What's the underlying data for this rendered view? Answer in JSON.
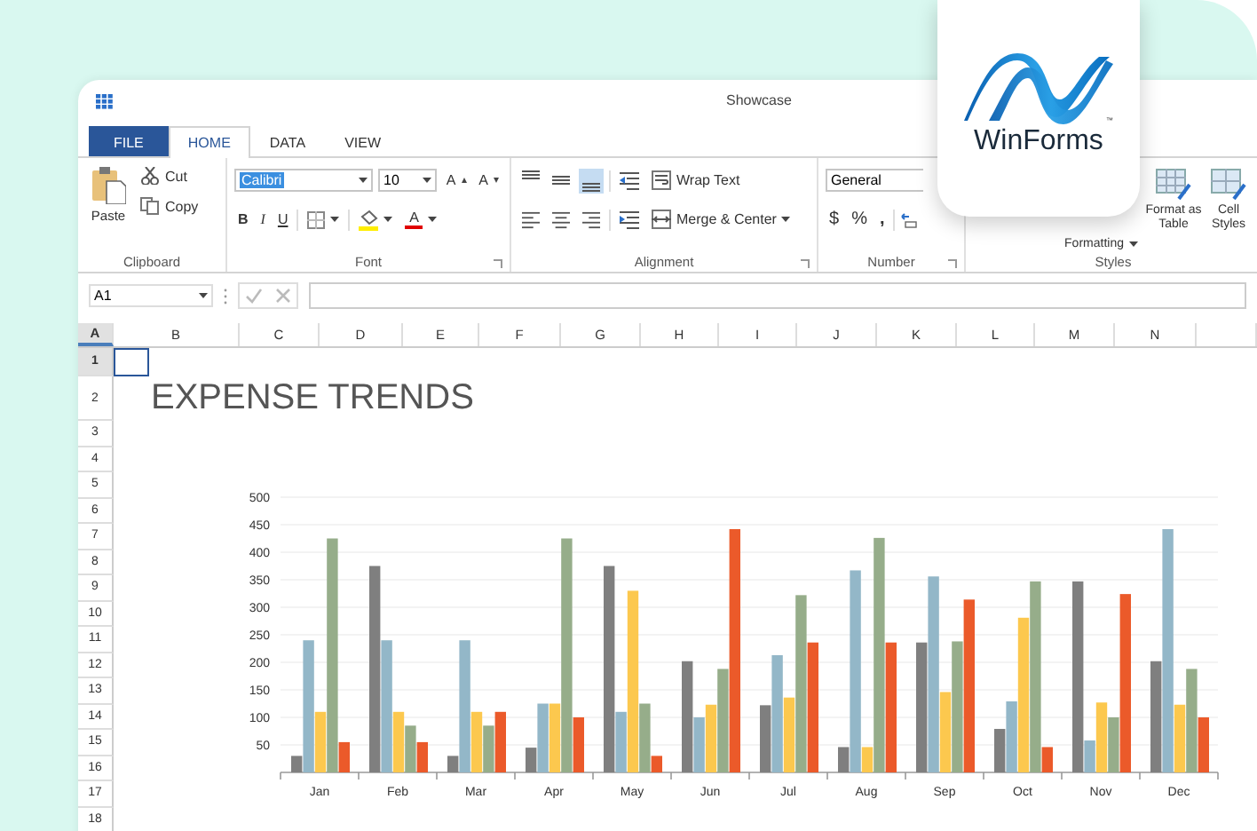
{
  "window": {
    "title": "Showcase"
  },
  "tabs": [
    {
      "label": "FILE",
      "kind": "backstage",
      "selected": false
    },
    {
      "label": "HOME",
      "kind": "tab",
      "selected": true
    },
    {
      "label": "DATA",
      "kind": "tab",
      "selected": false
    },
    {
      "label": "VIEW",
      "kind": "tab",
      "selected": false
    }
  ],
  "ribbon": {
    "clipboard": {
      "label": "Clipboard",
      "paste": "Paste",
      "cut": "Cut",
      "copy": "Copy"
    },
    "font": {
      "label": "Font",
      "family": "Calibri",
      "size": "10",
      "grow": "A",
      "shrink": "A",
      "bold": "B",
      "italic": "I",
      "underline": "U",
      "font_color": "A"
    },
    "alignment": {
      "label": "Alignment",
      "vertical": [
        {
          "selected": false
        },
        {
          "selected": false
        },
        {
          "selected": true
        }
      ],
      "horizontal": [
        {
          "selected": false
        },
        {
          "selected": false
        },
        {
          "selected": false
        }
      ],
      "wrap": "Wrap Text",
      "merge": "Merge & Center"
    },
    "number": {
      "label": "Number",
      "format": "General",
      "currency": "$",
      "percent": "%",
      "comma": ","
    },
    "styles": {
      "label": "Styles",
      "conditional": "Formatting",
      "table": "Format as Table",
      "cell": "Cell Styles"
    }
  },
  "formula_bar": {
    "name_box": "A1"
  },
  "sheet": {
    "columns": [
      {
        "label": "A",
        "selected": true
      },
      {
        "label": "B",
        "selected": false
      },
      {
        "label": "C",
        "selected": false
      },
      {
        "label": "D",
        "selected": false
      },
      {
        "label": "E",
        "selected": false
      },
      {
        "label": "F",
        "selected": false
      },
      {
        "label": "G",
        "selected": false
      },
      {
        "label": "H",
        "selected": false
      },
      {
        "label": "I",
        "selected": false
      },
      {
        "label": "J",
        "selected": false
      },
      {
        "label": "K",
        "selected": false
      },
      {
        "label": "L",
        "selected": false
      },
      {
        "label": "M",
        "selected": false
      },
      {
        "label": "N",
        "selected": false
      }
    ],
    "rows": [
      {
        "label": "1",
        "selected": true
      },
      {
        "label": "2",
        "selected": false
      },
      {
        "label": "3",
        "selected": false
      },
      {
        "label": "4",
        "selected": false
      },
      {
        "label": "5",
        "selected": false
      },
      {
        "label": "6",
        "selected": false
      },
      {
        "label": "7",
        "selected": false
      },
      {
        "label": "8",
        "selected": false
      },
      {
        "label": "9",
        "selected": false
      },
      {
        "label": "10",
        "selected": false
      },
      {
        "label": "11",
        "selected": false
      },
      {
        "label": "12",
        "selected": false
      },
      {
        "label": "13",
        "selected": false
      },
      {
        "label": "14",
        "selected": false
      },
      {
        "label": "15",
        "selected": false
      },
      {
        "label": "16",
        "selected": false
      },
      {
        "label": "17",
        "selected": false
      },
      {
        "label": "18",
        "selected": false
      }
    ],
    "title": "EXPENSE TRENDS",
    "chart": {
      "chart_data": {
        "type": "bar",
        "grid": true,
        "categories": [
          "Jan",
          "Feb",
          "Mar",
          "Apr",
          "May",
          "Jun",
          "Jul",
          "Aug",
          "Sep",
          "Oct",
          "Nov",
          "Dec"
        ],
        "ylim": [
          0,
          500
        ],
        "yticks": [
          50,
          100,
          150,
          200,
          250,
          300,
          350,
          400,
          450,
          500
        ],
        "series": [
          {
            "color": "#7f7f7f",
            "values": [
              30,
              375,
              30,
              45,
              375,
              202,
              122,
              46,
              236,
              79,
              347,
              202
            ]
          },
          {
            "color": "#93b7c8",
            "values": [
              240,
              240,
              240,
              125,
              110,
              100,
              213,
              367,
              356,
              129,
              58,
              442
            ]
          },
          {
            "color": "#fcc84e",
            "values": [
              110,
              110,
              110,
              125,
              330,
              123,
              136,
              46,
              146,
              281,
              127,
              123
            ]
          },
          {
            "color": "#96ad8a",
            "values": [
              425,
              85,
              85,
              425,
              125,
              188,
              322,
              426,
              238,
              347,
              100,
              188
            ]
          },
          {
            "color": "#eb5a2a",
            "values": [
              55,
              55,
              110,
              100,
              30,
              442,
              236,
              236,
              314,
              46,
              324,
              100
            ]
          }
        ]
      }
    }
  },
  "logo": {
    "text": "WinForms",
    "trademark": "™"
  }
}
